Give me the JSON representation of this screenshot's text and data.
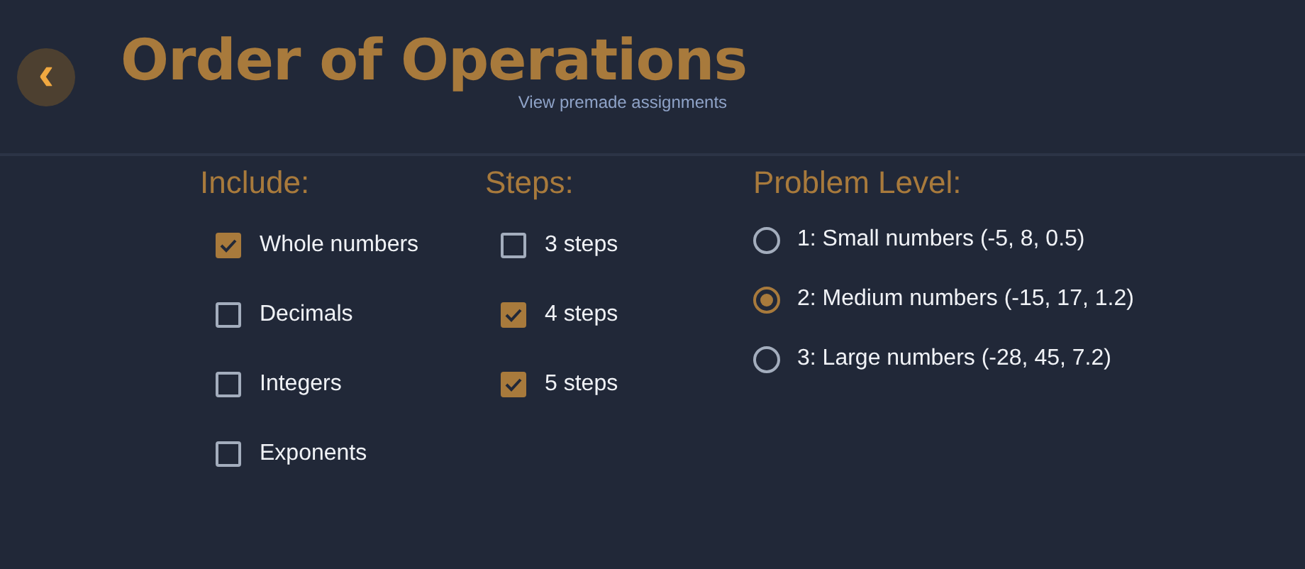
{
  "header": {
    "back_button": {
      "glyph": "‹"
    },
    "title": "Order of Operations",
    "link": "View premade assignments"
  },
  "include": {
    "heading": "Include:",
    "options": [
      {
        "label": "Whole numbers",
        "checked": true
      },
      {
        "label": "Decimals",
        "checked": false
      },
      {
        "label": "Integers",
        "checked": false
      },
      {
        "label": "Exponents",
        "checked": false
      }
    ]
  },
  "steps": {
    "heading": "Steps:",
    "options": [
      {
        "label": "3 steps",
        "checked": false
      },
      {
        "label": "4 steps",
        "checked": true
      },
      {
        "label": "5 steps",
        "checked": true
      }
    ]
  },
  "problem_level": {
    "heading": "Problem Level:",
    "options": [
      {
        "label": "1: Small numbers (-5, 8, 0.5)",
        "selected": false
      },
      {
        "label": "2: Medium numbers (-15, 17, 1.2)",
        "selected": true
      },
      {
        "label": "3: Large numbers (-28, 45, 7.2)",
        "selected": false
      }
    ]
  }
}
